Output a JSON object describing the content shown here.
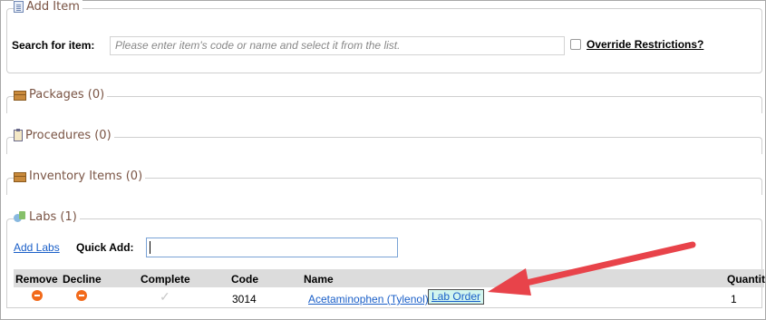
{
  "sections": {
    "add_item": "Add Item",
    "packages": "Packages (0)",
    "procedures": "Procedures (0)",
    "inventory": "Inventory Items (0)",
    "labs": "Labs (1)"
  },
  "search": {
    "label": "Search for item:",
    "placeholder": "Please enter item's code or name and select it from the list.",
    "override_label": "Override Restrictions?"
  },
  "labs_panel": {
    "add_labs": "Add Labs",
    "quick_add_label": "Quick Add:",
    "quick_add_value": ""
  },
  "table": {
    "headers": [
      "Remove",
      "Decline",
      "Complete",
      "Code",
      "Name",
      "Quantit"
    ],
    "rows": [
      {
        "code": "3014",
        "name": "Acetaminophen (Tylenol)",
        "tag": "Lab Order",
        "quantity": "1"
      }
    ]
  },
  "colors": {
    "accent_link": "#1a5fc8",
    "annotation_arrow": "#e8434a",
    "remove_icon": "#f26a1b"
  }
}
